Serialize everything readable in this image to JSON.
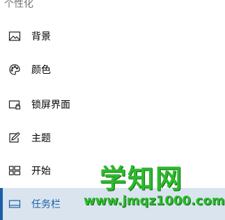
{
  "section": {
    "title": "个性化"
  },
  "nav": {
    "items": [
      {
        "label": "背景",
        "icon": "picture-icon"
      },
      {
        "label": "颜色",
        "icon": "palette-icon"
      },
      {
        "label": "锁屏界面",
        "icon": "lock-screen-icon"
      },
      {
        "label": "主题",
        "icon": "theme-icon"
      },
      {
        "label": "开始",
        "icon": "start-icon"
      },
      {
        "label": "任务栏",
        "icon": "taskbar-icon",
        "selected": true
      }
    ]
  },
  "watermark": {
    "main": "学知网",
    "url": "www.jmqz1000.com"
  },
  "colors": {
    "accent": "#1c5fa8",
    "selected_bg": "#d9e4ef",
    "watermark": "#2db92d"
  }
}
